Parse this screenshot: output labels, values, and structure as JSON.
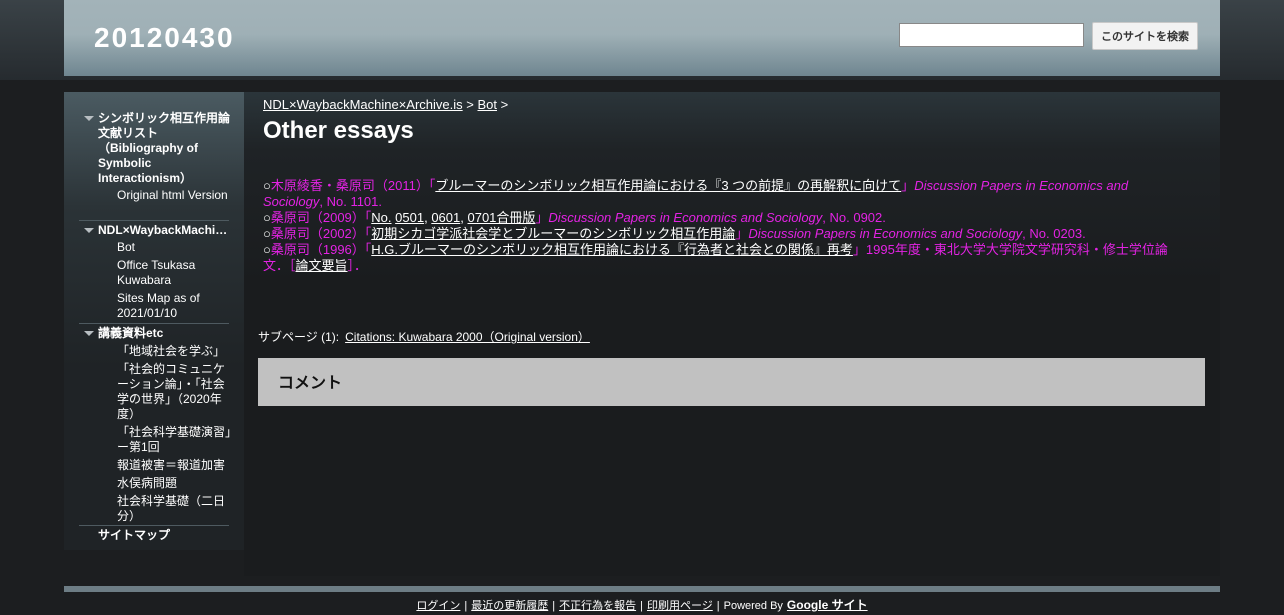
{
  "site": {
    "title": "20120430"
  },
  "search": {
    "placeholder": "",
    "button_label": "このサイトを検索"
  },
  "sidebar": {
    "items": [
      {
        "label": "シンボリック相互作用論文献リスト（Bibliography of Symbolic Interactionism）",
        "expanded": true,
        "children": [
          {
            "label": "Original html Version"
          }
        ]
      },
      {
        "label": "NDL×WaybackMachi…",
        "expanded": true,
        "children": [
          {
            "label": "Bot"
          },
          {
            "label": "Office Tsukasa Kuwabara"
          },
          {
            "label": "Sites Map as of 2021/01/10"
          }
        ]
      },
      {
        "label": "講義資料etc",
        "expanded": true,
        "children": [
          {
            "label": "「地域社会を学ぶ」"
          },
          {
            "label": "「社会的コミュニケーション論」・「社会学の世界」（2020年度）"
          },
          {
            "label": "「社会科学基礎演習」ー第1回"
          },
          {
            "label": "報道被害＝報道加害"
          },
          {
            "label": "水俣病問題"
          },
          {
            "label": "社会科学基礎（二日分）"
          }
        ]
      },
      {
        "label": "サイトマップ",
        "expanded": false,
        "children": []
      }
    ]
  },
  "breadcrumb": {
    "items": [
      "NDL×WaybackMachine×Archive.is",
      "Bot"
    ],
    "separator": ">"
  },
  "page": {
    "title": "Other essays"
  },
  "entries": [
    {
      "bullet": "○",
      "authors": "木原綾香・桑原司（2011）「",
      "title_link": "ブルーマーのシンボリック相互作用論における『3 つの前提』の再解釈に向けて",
      "close": "」",
      "journal": "Discussion Papers in Economics and Sociology",
      "rest": ", No. 1101."
    },
    {
      "bullet": "○",
      "authors": "桑原司（2009）「",
      "link1": "No.",
      "link2": "0501",
      "comma1": ",",
      "link3": "0601",
      "comma2": ",",
      "link4": "0701合冊版",
      "close": "」",
      "journal": "Discussion Papers in Economics and Sociology",
      "rest": ", No. 0902."
    },
    {
      "bullet": "○",
      "authors": "桑原司（2002）「",
      "title_link": "初期シカゴ学派社会学とブルーマーのシンボリック相互作用論",
      "close": "」",
      "journal": "Discussion Papers in Economics and Sociology",
      "rest": ", No. 0203."
    },
    {
      "bullet": "○",
      "authors": "桑原司（1996）「",
      "link_a": "H.G.ブルーマーのシンボリック相互作用論における『",
      "link_b": "行為者と社会との関係",
      "link_c": "』再考",
      "mid": "」1995年度・東北大学大学院文学研究科・修士学位論文．［",
      "link_d": "論文要旨",
      "end": "］．"
    }
  ],
  "subpages": {
    "label": "サブページ (1):",
    "link": "Citations: Kuwabara 2000（Original version）"
  },
  "comments": {
    "title": "コメント"
  },
  "footer": {
    "links": [
      "ログイン",
      "最近の更新履歴",
      "不正行為を報告",
      "印刷用ページ"
    ],
    "powered_by": "Powered By",
    "google_sites": "Google サイト"
  }
}
